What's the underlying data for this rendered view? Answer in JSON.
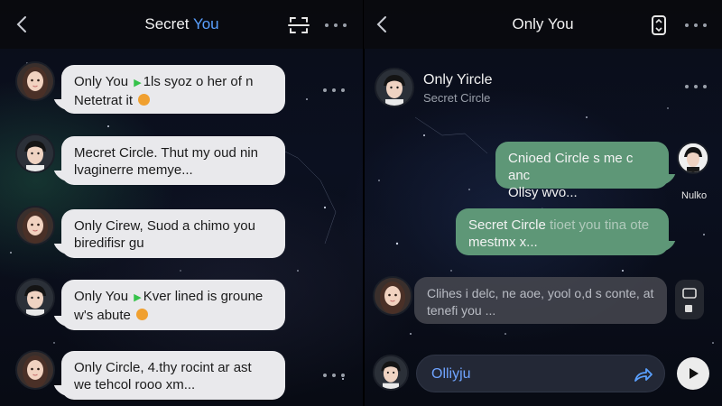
{
  "left": {
    "title_main": "Secret ",
    "title_accent": "You",
    "icons": {
      "back": "chevron-left-icon",
      "scan": "scan-frame-icon",
      "more": "more-dots-icon"
    },
    "messages": [
      {
        "line1_pre": "Only You",
        "line1_post": "1ls syoz o her of n",
        "line2": "Netetrat it"
      },
      {
        "line1": "Mecret Circle. Thut my oud nin",
        "line2": "lvaginerre memye..."
      },
      {
        "line1": "Only Cirew, Suod a chimo you",
        "line2": "biredifisr gu"
      },
      {
        "line1_pre": "Only You",
        "line1_post": "Kver lined is groune",
        "line2": "w's abute"
      },
      {
        "line1": "Only Circle, 4.thy rocint ar ast",
        "line2": "we tehcol rooo xm..."
      }
    ]
  },
  "right": {
    "title": "Only You",
    "icons": {
      "back": "chevron-left-icon",
      "rotate": "rotate-phone-icon",
      "more": "more-dots-icon"
    },
    "contact": {
      "name": "Only Yircle",
      "subtitle": "Secret Circle"
    },
    "sent": [
      {
        "line1": "Cnioed Circle s me c anc",
        "line2": "Ollsy wvo..."
      },
      {
        "line1_pre": "Secret Circle",
        "line1_post": "tioet you tina ote",
        "line2": "mestmx x..."
      }
    ],
    "received": {
      "line1": "Clihes i delc, ne aoe, yool o,d s conte, at",
      "line2": "tenefi you ..."
    },
    "side_label": "Nulko",
    "input_value": "Olliyju",
    "accent_color": "#5aa0ff",
    "bubble_green": "#5e9777"
  }
}
